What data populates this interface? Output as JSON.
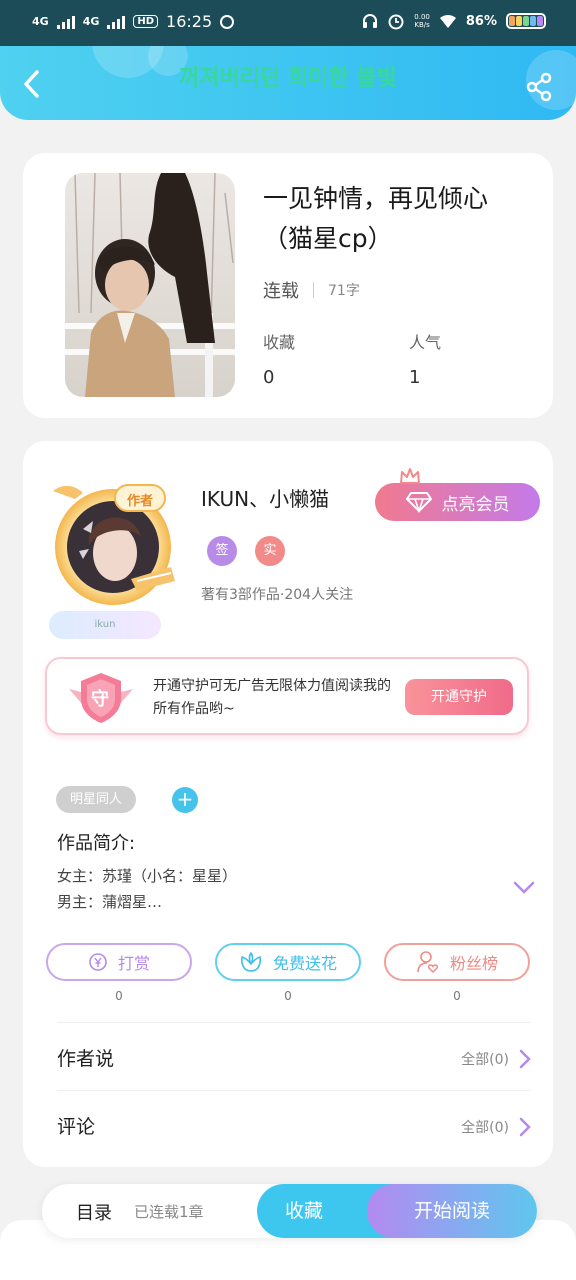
{
  "status_bar": {
    "network1": "4G",
    "network2": "4G",
    "hd": "HD",
    "time": "16:25",
    "speed": "0.00",
    "speed_unit": "KB/s",
    "battery": "86%"
  },
  "header": {
    "title": "꺼져버리던 희미한 불빛"
  },
  "book": {
    "title": "一见钟情，再见倾心（猫星cp）",
    "status": "连载",
    "word_count": "71字",
    "favorites_label": "收藏",
    "favorites_value": "0",
    "popularity_label": "人气",
    "popularity_value": "1"
  },
  "author": {
    "name": "IKUN、小懒猫",
    "avatar_badge": "作者",
    "tag": "ikun",
    "vip_label": "点亮会员",
    "badges": [
      "签",
      "实"
    ],
    "meta": "著有3部作品·204人关注"
  },
  "guard": {
    "icon_char": "守",
    "text": "开通守护可无广告无限体力值阅读我的所有作品哟~",
    "button": "开通守护"
  },
  "intro": {
    "genre_tag": "明星同人",
    "add_label": "+",
    "heading": "作品简介:",
    "line1": "女主：苏瑾（小名：星星）",
    "line2": "男主：蒲熠星…"
  },
  "actions": [
    {
      "label": "打赏",
      "count": "0"
    },
    {
      "label": "免费送花",
      "count": "0"
    },
    {
      "label": "粉丝榜",
      "count": "0"
    }
  ],
  "author_says": {
    "label": "作者说",
    "right": "全部(0)"
  },
  "comments": {
    "label": "评论",
    "right": "全部(0)"
  },
  "bottom_bar": {
    "toc": "目录",
    "toc_sub": "已连载1章",
    "favorite": "收藏",
    "start_reading": "开始阅读"
  },
  "colors": {
    "header_accent": "#2fb9f3",
    "title_green": "#38d89a",
    "vip_pink": "#f07a8f",
    "purple": "#b48af0",
    "cyan": "#3dc7ef",
    "coral": "#f08a84"
  }
}
